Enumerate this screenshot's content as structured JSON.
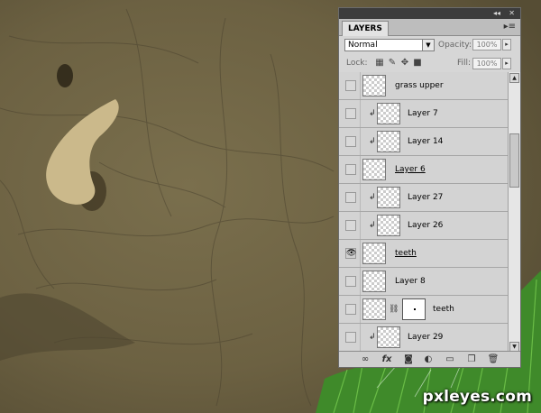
{
  "panel": {
    "tab_label": "LAYERS",
    "blend_mode": "Normal",
    "opacity_label": "Opacity:",
    "opacity_value": "100%",
    "lock_label": "Lock:",
    "fill_label": "Fill:",
    "fill_value": "100%",
    "layers": [
      {
        "name": "grass upper",
        "visible": false,
        "clipped": false,
        "mask": false,
        "underline": false
      },
      {
        "name": "Layer 7",
        "visible": false,
        "clipped": true,
        "mask": false,
        "underline": false
      },
      {
        "name": "Layer 14",
        "visible": false,
        "clipped": true,
        "mask": false,
        "underline": false
      },
      {
        "name": "Layer 6",
        "visible": false,
        "clipped": false,
        "mask": false,
        "underline": true
      },
      {
        "name": "Layer 27",
        "visible": false,
        "clipped": true,
        "mask": false,
        "underline": false
      },
      {
        "name": "Layer 26",
        "visible": false,
        "clipped": true,
        "mask": false,
        "underline": false
      },
      {
        "name": "teeth",
        "visible": true,
        "clipped": false,
        "mask": false,
        "underline": true
      },
      {
        "name": "Layer 8",
        "visible": false,
        "clipped": false,
        "mask": false,
        "underline": false
      },
      {
        "name": "teeth",
        "visible": false,
        "clipped": false,
        "mask": true,
        "underline": false
      },
      {
        "name": "Layer 29",
        "visible": false,
        "clipped": true,
        "mask": false,
        "underline": false
      }
    ]
  },
  "watermark": "pxleyes.com",
  "colors": {
    "canvas_bg": "#6f6647",
    "tusk": "#cbb98b",
    "grass": "#3f8a2a",
    "panel_bg": "#d6d6d6"
  },
  "icons": {
    "eye": "eye-icon",
    "clip": "clip-arrow-icon",
    "chain": "chain-link-icon",
    "lock_transparent": "lock-transparent-icon",
    "lock_paint": "brush-icon",
    "lock_move": "move-icon",
    "lock_all": "padlock-icon"
  }
}
